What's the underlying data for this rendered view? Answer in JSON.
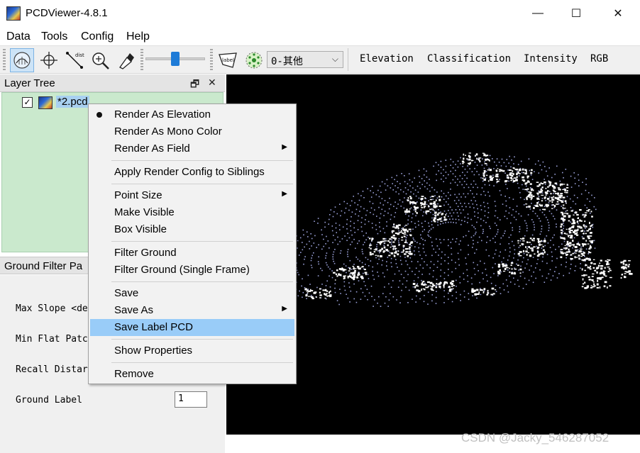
{
  "window": {
    "title": "PCDViewer-4.8.1",
    "controls": {
      "minimize": "—",
      "maximize": "☐",
      "close": "✕"
    }
  },
  "menubar": [
    "Data",
    "Tools",
    "Config",
    "Help"
  ],
  "toolbar": {
    "slider_value_fraction": 0.45,
    "class_combo": {
      "selected": "0-其他"
    },
    "render_modes": [
      "Elevation",
      "Classification",
      "Intensity",
      "RGB"
    ]
  },
  "layer_tree": {
    "title": "Layer Tree",
    "float_icon": "🗗",
    "close_icon": "✕",
    "items": [
      {
        "label": "*2.pcd",
        "checked": true
      }
    ]
  },
  "ground_filter": {
    "title": "Ground Filter Pa",
    "params": [
      {
        "label": "Max Slope <de",
        "value": ""
      },
      {
        "label": "Min Flat Patc",
        "value": ""
      },
      {
        "label": "Recall Distar",
        "value": ""
      },
      {
        "label": "Ground Label",
        "value": "1"
      }
    ]
  },
  "context_menu": {
    "groups": [
      [
        {
          "label": "Render As Elevation",
          "checked": true,
          "submenu": false
        },
        {
          "label": "Render As Mono Color",
          "checked": false,
          "submenu": false
        },
        {
          "label": "Render As Field",
          "checked": false,
          "submenu": true
        }
      ],
      [
        {
          "label": "Apply Render Config to Siblings",
          "checked": false,
          "submenu": false
        }
      ],
      [
        {
          "label": "Point Size",
          "checked": false,
          "submenu": true
        },
        {
          "label": "Make Visible",
          "checked": false,
          "submenu": false
        },
        {
          "label": "Box Visible",
          "checked": false,
          "submenu": false
        }
      ],
      [
        {
          "label": "Filter Ground",
          "checked": false,
          "submenu": false
        },
        {
          "label": "Filter Ground (Single Frame)",
          "checked": false,
          "submenu": false
        }
      ],
      [
        {
          "label": "Save",
          "checked": false,
          "submenu": false
        },
        {
          "label": "Save As",
          "checked": false,
          "submenu": true
        },
        {
          "label": "Save Label PCD",
          "checked": false,
          "submenu": false,
          "highlighted": true
        }
      ],
      [
        {
          "label": "Show Properties",
          "checked": false,
          "submenu": false
        }
      ],
      [
        {
          "label": "Remove",
          "checked": false,
          "submenu": false
        }
      ]
    ]
  },
  "watermark": "CSDN @Jacky_546287052",
  "colors": {
    "accent": "#1e7bd7",
    "menu_highlight": "#99ccf8",
    "layer_bg": "#cae9cd",
    "viewport_bg": "#000000",
    "points": "#ffffff",
    "ground_points": "#9aa0d8"
  }
}
